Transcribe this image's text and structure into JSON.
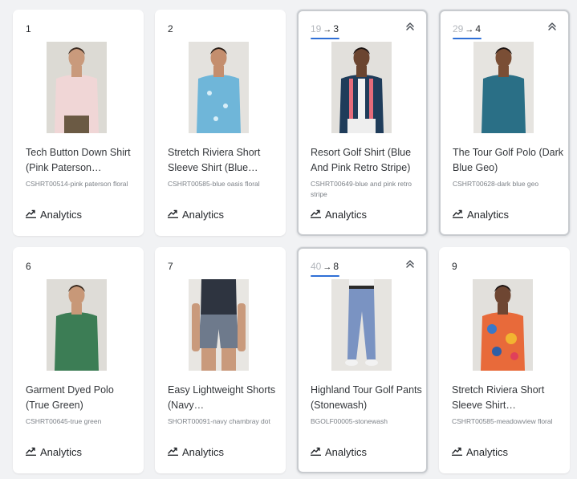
{
  "analytics_label": "Analytics",
  "arrow_glyph": "→",
  "products": [
    {
      "rank": "1",
      "title": "Tech Button Down Shirt (Pink Paterson…",
      "sku": "CSHRT00514-pink paterson floral",
      "moved": false,
      "bg": "#dcdad4",
      "shirt": "#f0d6d6",
      "pants": "#6b5a44",
      "skin": "#c99a7c",
      "hair": "#3b2a20"
    },
    {
      "rank": "2",
      "title": "Stretch Riviera Short Sleeve Shirt (Blue…",
      "sku": "CSHRT00585-blue oasis floral",
      "moved": false,
      "bg": "#e4e2de",
      "shirt": "#6fb6d9",
      "pants": "#6fb6d9",
      "skin": "#c48e6e",
      "hair": "#2a1e17"
    },
    {
      "rank": "3",
      "old_rank": "19",
      "title": "Resort Golf Shirt (Blue And Pink Retro Stripe)",
      "sku": "CSHRT00649-blue and pink retro stripe",
      "moved": true,
      "bg": "#e2e0dc",
      "shirt": "#1f3c5a",
      "pants": "#eeeeee",
      "skin": "#6b4530",
      "hair": "#1a1210"
    },
    {
      "rank": "4",
      "old_rank": "29",
      "title": "The Tour Golf Polo (Dark Blue Geo)",
      "sku": "CSHRT00628-dark blue geo",
      "moved": true,
      "bg": "#e6e4e0",
      "shirt": "#2a6f86",
      "pants": "#2a6f86",
      "skin": "#7a4e35",
      "hair": "#1a1210"
    },
    {
      "rank": "6",
      "title": "Garment Dyed Polo (True Green)",
      "sku": "CSHRT00645-true green",
      "moved": false,
      "bg": "#dedcd7",
      "shirt": "#3c7d55",
      "pants": "#3c7d55",
      "skin": "#c89878",
      "hair": "#3a2a1e"
    },
    {
      "rank": "7",
      "title": "Easy Lightweight Shorts (Navy…",
      "sku": "SHORT00091-navy chambray dot",
      "moved": false,
      "bg": "#e8e6e2",
      "shirt": "#2e3440",
      "pants": "#6e7a8c",
      "skin": "#c99a7c",
      "hair": "#e8e6e2"
    },
    {
      "rank": "8",
      "old_rank": "40",
      "title": "Highland Tour Golf Pants (Stonewash)",
      "sku": "BGOLF00005-stonewash",
      "moved": true,
      "bg": "#e6e4e0",
      "shirt": "#e6e4e0",
      "pants": "#7a93c2",
      "skin": "#e6e4e0",
      "hair": "#e6e4e0"
    },
    {
      "rank": "9",
      "title": "Stretch Riviera Short Sleeve Shirt…",
      "sku": "CSHRT00585-meadowview floral",
      "moved": false,
      "bg": "#e2e0dc",
      "shirt": "#e86a3a",
      "pants": "#3a66a8",
      "skin": "#6e4632",
      "hair": "#1a1210"
    }
  ]
}
